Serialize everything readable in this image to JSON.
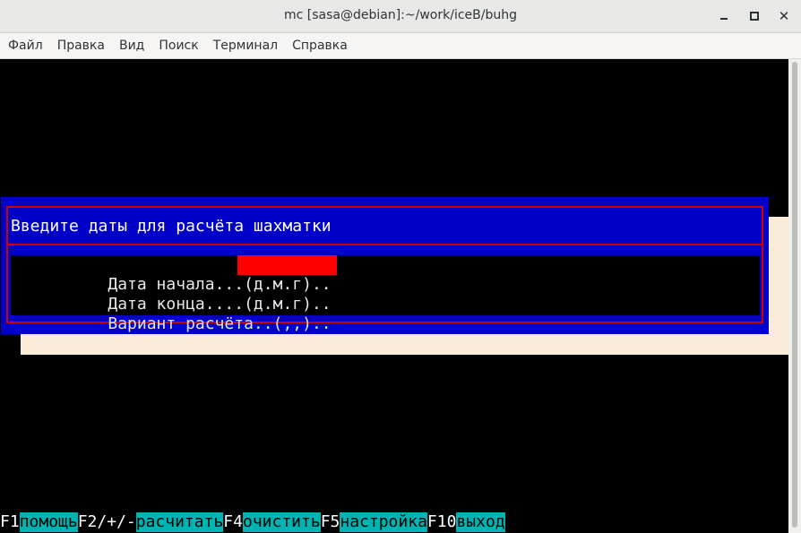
{
  "window": {
    "title": "mc [sasa@debian]:~/work/iceB/buhg"
  },
  "menu": {
    "items": [
      "Файл",
      "Правка",
      "Вид",
      "Поиск",
      "Терминал",
      "Справка"
    ]
  },
  "dialog": {
    "title": "Введите даты для расчёта шахматки",
    "fields": [
      {
        "label": "Дата начала...(д.м.г)..",
        "value": ""
      },
      {
        "label": "Дата конца....(д.м.г)..",
        "value": ""
      },
      {
        "label": "Вариант расчёта..(,,)..",
        "value": ""
      }
    ]
  },
  "fkeys": [
    {
      "key": "F1",
      "label": "помощь"
    },
    {
      "key": "F2/+/-",
      "label": "расчитать"
    },
    {
      "key": "F4",
      "label": "очистить"
    },
    {
      "key": "F5",
      "label": "настройка"
    },
    {
      "key": "F10",
      "label": "выход"
    }
  ],
  "colors": {
    "dialog_bg": "#0000c8",
    "frame": "#d00000",
    "input_active": "#ff0000",
    "fkey_label_bg": "#00b3b3",
    "shadow": "#fbebd9"
  }
}
